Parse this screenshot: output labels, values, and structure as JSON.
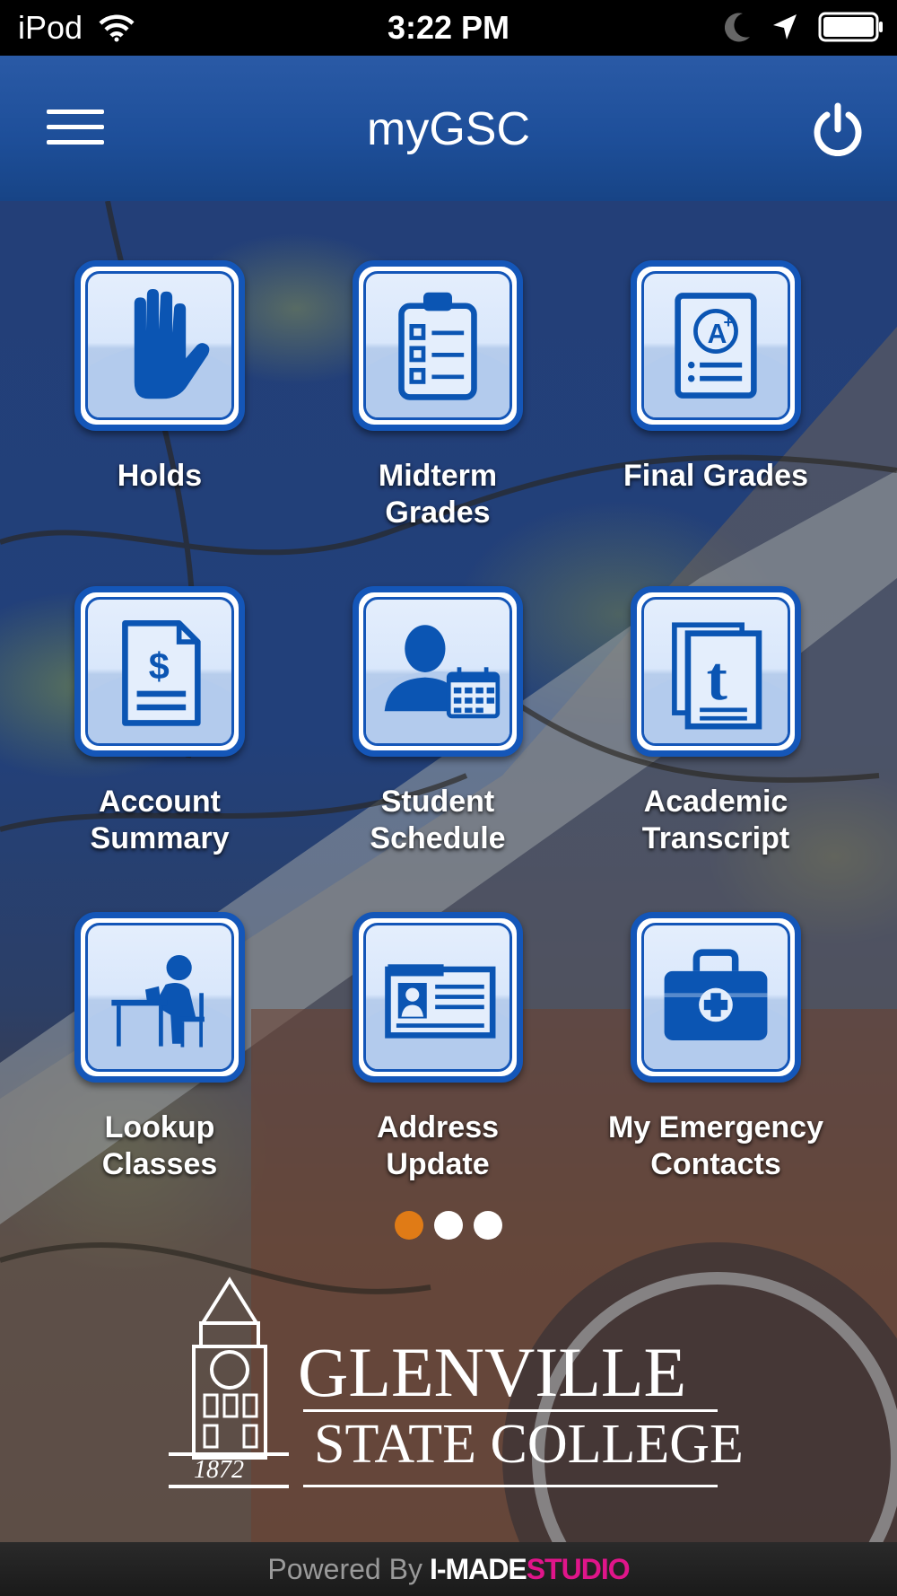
{
  "status_bar": {
    "carrier": "iPod",
    "time": "3:22 PM",
    "icons": [
      "wifi-icon",
      "moon-icon",
      "location-arrow-icon",
      "battery-icon"
    ]
  },
  "nav": {
    "title": "myGSC",
    "menu_icon": "hamburger-menu-icon",
    "power_icon": "power-icon"
  },
  "tiles": [
    {
      "label": "Holds",
      "icon": "hand-icon"
    },
    {
      "label": "Midterm\nGrades",
      "icon": "clipboard-checklist-icon"
    },
    {
      "label": "Final Grades",
      "icon": "graded-paper-icon"
    },
    {
      "label": "Account\nSummary",
      "icon": "dollar-document-icon"
    },
    {
      "label": "Student\nSchedule",
      "icon": "person-calendar-icon"
    },
    {
      "label": "Academic\nTranscript",
      "icon": "transcript-icon"
    },
    {
      "label": "Lookup\nClasses",
      "icon": "student-desk-icon"
    },
    {
      "label": "Address\nUpdate",
      "icon": "id-card-icon"
    },
    {
      "label": "My Emergency\nContacts",
      "icon": "first-aid-kit-icon"
    }
  ],
  "pager": {
    "pages": 3,
    "active": 1
  },
  "logo": {
    "line1": "GLENVILLE",
    "line2": "STATE COLLEGE",
    "year": "1872"
  },
  "footer": {
    "powered_by": "Powered By",
    "brand_part1": "I-MADE",
    "brand_part2": "STUDIO"
  },
  "colors": {
    "nav_blue": "#1e4f9a",
    "tile_border": "#1456b8",
    "pager_active": "#e07b16",
    "brand_pink": "#e0158a"
  }
}
